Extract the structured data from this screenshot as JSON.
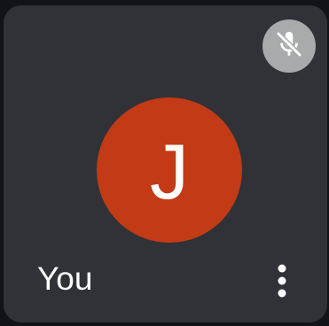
{
  "participant": {
    "name": "You",
    "initial": "J",
    "avatar_color": "#c23b16"
  },
  "controls": {
    "mic_status_icon": "mic-off-icon",
    "more_icon": "more-vert-icon"
  },
  "colors": {
    "tile_background": "#313237",
    "mic_badge_background": "#a9aaab"
  }
}
